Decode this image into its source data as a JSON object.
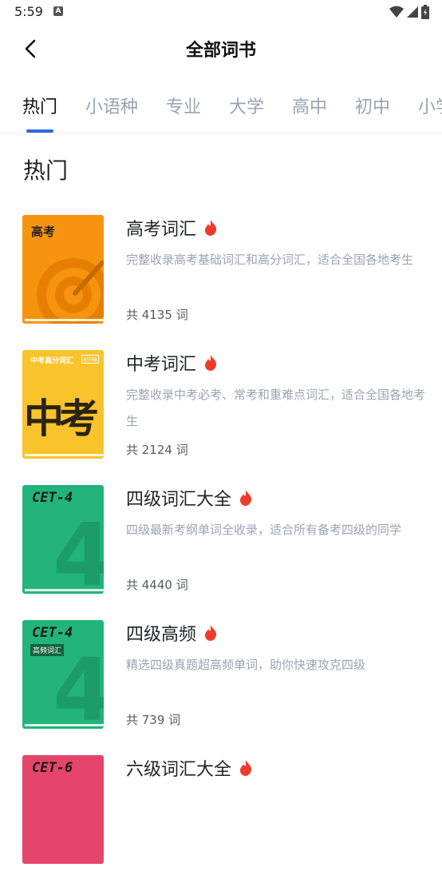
{
  "status": {
    "time": "5:59",
    "notif": "A"
  },
  "header": {
    "title": "全部词书"
  },
  "tabs": [
    "热门",
    "小语种",
    "专业",
    "大学",
    "高中",
    "初中",
    "小学"
  ],
  "section": {
    "title": "热门"
  },
  "books": [
    {
      "name": "高考词汇",
      "desc": "完整收录高考基础词汇和高分词汇，适合全国各地考生",
      "count": "共 4135 词",
      "cover": {
        "label": "高考",
        "color": "#f7940f"
      }
    },
    {
      "name": "中考词汇",
      "desc": "完整收录中考必考、常考和重难点词汇，适合全国各地考生",
      "count": "共 2124 词",
      "cover": {
        "label": "中考高分词汇",
        "badge": "初中版",
        "big": "中考",
        "color": "#f9c32b"
      }
    },
    {
      "name": "四级词汇大全",
      "desc": "四级最新考纲单词全收录，适合所有备考四级的同学",
      "count": "共 4440 词",
      "cover": {
        "label": "CET-4",
        "big": "4",
        "color": "#22b47a"
      }
    },
    {
      "name": "四级高频",
      "desc": "精选四级真题超高频单词，助你快速攻克四级",
      "count": "共 739 词",
      "cover": {
        "label": "CET-4",
        "sub": "高频词汇",
        "big": "4",
        "color": "#22b47a"
      }
    },
    {
      "name": "六级词汇大全",
      "count": "",
      "cover": {
        "label": "CET-6",
        "color": "#e5456a"
      }
    }
  ],
  "colors": {
    "accent": "#2f6ae0",
    "hot": "#ef3b2c"
  }
}
